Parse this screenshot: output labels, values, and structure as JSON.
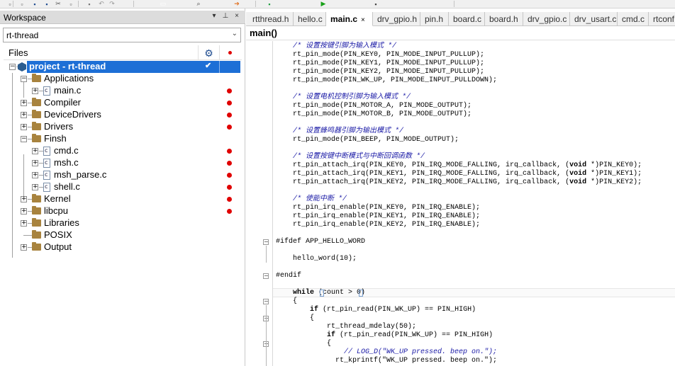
{
  "toolbar": {
    "icons": [
      "new-file-icon",
      "open-file-icon",
      "save-icon",
      "save-all-icon",
      "cut-icon",
      "copy-icon",
      "paste-icon",
      "undo-icon",
      "redo-icon",
      "search-icon",
      "search-in-files-icon",
      "navigate-forward-icon",
      "navigate-back-icon",
      "debug-icon",
      "run-icon",
      "options-icon"
    ]
  },
  "workspace": {
    "title": "Workspace",
    "pin_glyph": "▾",
    "dock_glyph": "⊥",
    "close_glyph": "×",
    "project_selector": "rt-thread",
    "files_header": "Files"
  },
  "tree": [
    {
      "label": "project - rt-thread",
      "kind": "project",
      "depth": 0,
      "expander": "−",
      "check": true,
      "dot": false
    },
    {
      "label": "Applications",
      "kind": "folder",
      "depth": 1,
      "expander": "−",
      "dot": false
    },
    {
      "label": "main.c",
      "kind": "file",
      "depth": 2,
      "expander": "+",
      "dot": true
    },
    {
      "label": "Compiler",
      "kind": "folder",
      "depth": 1,
      "expander": "+",
      "dot": true
    },
    {
      "label": "DeviceDrivers",
      "kind": "folder",
      "depth": 1,
      "expander": "+",
      "dot": true
    },
    {
      "label": "Drivers",
      "kind": "folder",
      "depth": 1,
      "expander": "+",
      "dot": true
    },
    {
      "label": "Finsh",
      "kind": "folder",
      "depth": 1,
      "expander": "−",
      "dot": false
    },
    {
      "label": "cmd.c",
      "kind": "file",
      "depth": 2,
      "expander": "+",
      "dot": true
    },
    {
      "label": "msh.c",
      "kind": "file",
      "depth": 2,
      "expander": "+",
      "dot": true
    },
    {
      "label": "msh_parse.c",
      "kind": "file",
      "depth": 2,
      "expander": "+",
      "dot": true
    },
    {
      "label": "shell.c",
      "kind": "file",
      "depth": 2,
      "expander": "+",
      "dot": true
    },
    {
      "label": "Kernel",
      "kind": "folder",
      "depth": 1,
      "expander": "+",
      "dot": true
    },
    {
      "label": "libcpu",
      "kind": "folder",
      "depth": 1,
      "expander": "+",
      "dot": true
    },
    {
      "label": "Libraries",
      "kind": "folder",
      "depth": 1,
      "expander": "+",
      "dot": false
    },
    {
      "label": "POSIX",
      "kind": "folder",
      "depth": 1,
      "expander": "",
      "dot": false
    },
    {
      "label": "Output",
      "kind": "folder",
      "depth": 1,
      "expander": "+",
      "dot": false
    }
  ],
  "editor": {
    "tabs": [
      {
        "label": "rtthread.h",
        "active": false
      },
      {
        "label": "hello.c",
        "active": false
      },
      {
        "label": "main.c",
        "active": true,
        "close": "×"
      },
      {
        "label": "drv_gpio.h",
        "active": false
      },
      {
        "label": "pin.h",
        "active": false
      },
      {
        "label": "board.c",
        "active": false
      },
      {
        "label": "board.h",
        "active": false
      },
      {
        "label": "drv_gpio.c",
        "active": false
      },
      {
        "label": "drv_usart.c",
        "active": false
      },
      {
        "label": "cmd.c",
        "active": false
      },
      {
        "label": "rtconf",
        "active": false
      }
    ],
    "function_bar": "main()",
    "code_lines": [
      "    /* 设置按键引脚为输入模式 */",
      "    rt_pin_mode(PIN_KEY0, PIN_MODE_INPUT_PULLUP);",
      "    rt_pin_mode(PIN_KEY1, PIN_MODE_INPUT_PULLUP);",
      "    rt_pin_mode(PIN_KEY2, PIN_MODE_INPUT_PULLUP);",
      "    rt_pin_mode(PIN_WK_UP, PIN_MODE_INPUT_PULLDOWN);",
      "",
      "    /* 设置电机控制引脚为输入模式 */",
      "    rt_pin_mode(PIN_MOTOR_A, PIN_MODE_OUTPUT);",
      "    rt_pin_mode(PIN_MOTOR_B, PIN_MODE_OUTPUT);",
      "",
      "    /* 设置蜂鸣器引脚为输出模式 */",
      "    rt_pin_mode(PIN_BEEP, PIN_MODE_OUTPUT);",
      "",
      "    /* 设置按键中断模式与中断回调函数 */",
      "    rt_pin_attach_irq(PIN_KEY0, PIN_IRQ_MODE_FALLING, irq_callback, (void *)PIN_KEY0);",
      "    rt_pin_attach_irq(PIN_KEY1, PIN_IRQ_MODE_FALLING, irq_callback, (void *)PIN_KEY1);",
      "    rt_pin_attach_irq(PIN_KEY2, PIN_IRQ_MODE_FALLING, irq_callback, (void *)PIN_KEY2);",
      "",
      "    /* 使能中断 */",
      "    rt_pin_irq_enable(PIN_KEY0, PIN_IRQ_ENABLE);",
      "    rt_pin_irq_enable(PIN_KEY1, PIN_IRQ_ENABLE);",
      "    rt_pin_irq_enable(PIN_KEY2, PIN_IRQ_ENABLE);",
      "",
      "#ifdef APP_HELLO_WORD",
      "",
      "    hello_word(10);",
      "",
      "#endif",
      "",
      "    while (count > 0)",
      "    {",
      "        if (rt_pin_read(PIN_WK_UP) == PIN_HIGH)",
      "        {",
      "            rt_thread_mdelay(50);",
      "            if (rt_pin_read(PIN_WK_UP) == PIN_HIGH)",
      "            {",
      "                // LOG_D(\"WK_UP pressed. beep on.\");",
      "              rt_kprintf(\"WK_UP pressed. beep on.\");"
    ]
  }
}
